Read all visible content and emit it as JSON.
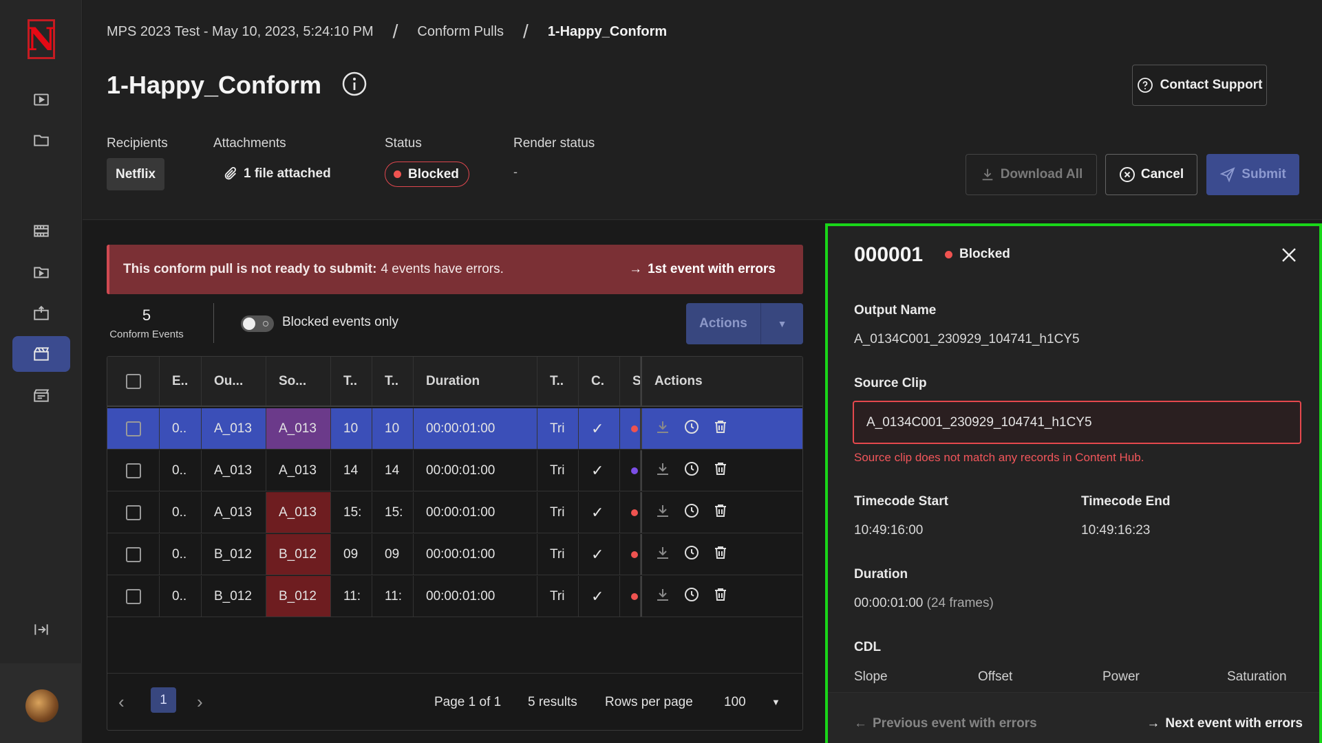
{
  "sidebar": {
    "logo_letter": "N",
    "items": [
      {
        "icon": "play-box-icon"
      },
      {
        "icon": "folder-icon"
      },
      {
        "icon": "film-strip-icon"
      },
      {
        "icon": "folder-play-icon"
      },
      {
        "icon": "media-upload-icon"
      },
      {
        "icon": "clapperboard-icon"
      },
      {
        "icon": "clapper-list-icon"
      }
    ],
    "active_index": 5,
    "collapse_icon": "collapse-sidebar-icon"
  },
  "breadcrumb": {
    "items": [
      "MPS 2023 Test - May 10, 2023, 5:24:10 PM",
      "Conform Pulls",
      "1-Happy_Conform"
    ],
    "separator": "/"
  },
  "header": {
    "title": "1-Happy_Conform",
    "contact_support": "Contact Support",
    "recipients_label": "Recipients",
    "recipients_value": "Netflix",
    "attachments_label": "Attachments",
    "attachments_value": "1 file attached",
    "status_label": "Status",
    "status_value": "Blocked",
    "render_status_label": "Render status",
    "render_status_value": "-",
    "download_all": "Download All",
    "cancel": "Cancel",
    "submit": "Submit"
  },
  "alert": {
    "bold": "This conform pull is not ready to submit:",
    "text": "4 events have errors.",
    "link": "1st event with errors"
  },
  "toolbar": {
    "count": "5",
    "count_label": "Conform Events",
    "toggle_label": "Blocked events only",
    "actions_label": "Actions"
  },
  "table": {
    "columns": [
      "E..",
      "Ou...",
      "So...",
      "T..",
      "T..",
      "Duration",
      "T..",
      "C.",
      "S",
      "Actions"
    ],
    "rows": [
      {
        "e": "0..",
        "out": "A_013",
        "src": "A_013",
        "t1": "10",
        "t2": "10",
        "dur": "00:00:01:00",
        "type": "Tri",
        "dot": "#ef5350",
        "selected": true,
        "src_err": true
      },
      {
        "e": "0..",
        "out": "A_013",
        "src": "A_013",
        "t1": "14",
        "t2": "14",
        "dur": "00:00:01:00",
        "type": "Tri",
        "dot": "#7b4ee6",
        "selected": false,
        "src_err": false
      },
      {
        "e": "0..",
        "out": "A_013",
        "src": "A_013",
        "t1": "15:",
        "t2": "15:",
        "dur": "00:00:01:00",
        "type": "Tri",
        "dot": "#ef5350",
        "selected": false,
        "src_err": true
      },
      {
        "e": "0..",
        "out": "B_012",
        "src": "B_012",
        "t1": "09",
        "t2": "09",
        "dur": "00:00:01:00",
        "type": "Tri",
        "dot": "#ef5350",
        "selected": false,
        "src_err": true
      },
      {
        "e": "0..",
        "out": "B_012",
        "src": "B_012",
        "t1": "11:",
        "t2": "11:",
        "dur": "00:00:01:00",
        "type": "Tri",
        "dot": "#ef5350",
        "selected": false,
        "src_err": true
      }
    ]
  },
  "pagination": {
    "current_page": "1",
    "page_text": "Page 1 of 1",
    "results": "5 results",
    "rows_label": "Rows per page",
    "rows_value": "100"
  },
  "panel": {
    "id": "000001",
    "status": "Blocked",
    "output_name_label": "Output Name",
    "output_name": "A_0134C001_230929_104741_h1CY5",
    "source_clip_label": "Source Clip",
    "source_clip": "A_0134C001_230929_104741_h1CY5",
    "source_error": "Source clip does not match any records in Content Hub.",
    "tc_start_label": "Timecode Start",
    "tc_start": "10:49:16:00",
    "tc_end_label": "Timecode End",
    "tc_end": "10:49:16:23",
    "duration_label": "Duration",
    "duration": "00:00:01:00",
    "duration_frames": "(24 frames)",
    "cdl_label": "CDL",
    "cdl_cols": [
      "Slope",
      "Offset",
      "Power",
      "Saturation"
    ],
    "prev": "Previous event with errors",
    "next": "Next event with errors"
  },
  "colors": {
    "accent": "#3b4b8f",
    "selected_row": "#3b4fb8",
    "error": "#e5484d",
    "highlight_border": "#19d619"
  }
}
